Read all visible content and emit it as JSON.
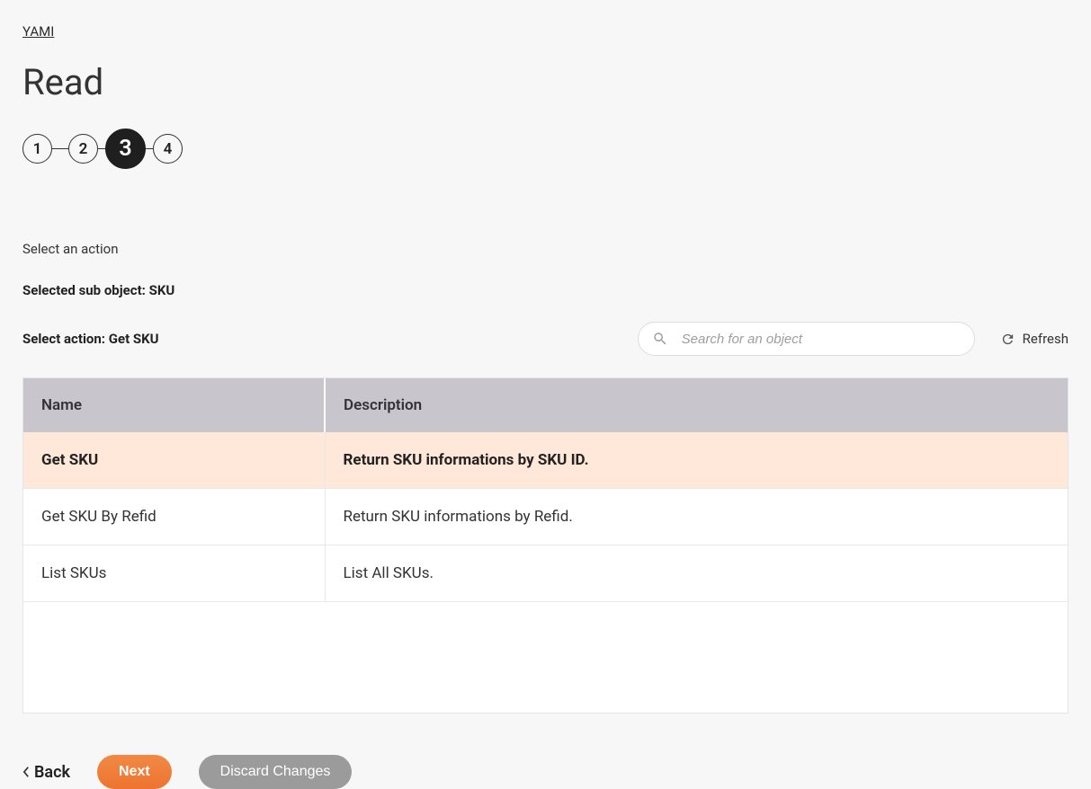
{
  "breadcrumb": {
    "link": "YAMI"
  },
  "pageTitle": "Read",
  "stepper": {
    "steps": [
      "1",
      "2",
      "3",
      "4"
    ],
    "activeIndex": 2
  },
  "instruction": "Select an action",
  "subObject": {
    "label": "Selected sub object: ",
    "value": "SKU"
  },
  "selectAction": {
    "label": "Select action: ",
    "value": "Get SKU"
  },
  "search": {
    "placeholder": "Search for an object"
  },
  "refresh": {
    "label": "Refresh"
  },
  "table": {
    "headers": {
      "name": "Name",
      "description": "Description"
    },
    "rows": [
      {
        "name": "Get SKU",
        "description": "Return SKU informations by SKU ID.",
        "selected": true
      },
      {
        "name": "Get SKU By Refid",
        "description": "Return SKU informations by Refid.",
        "selected": false
      },
      {
        "name": "List SKUs",
        "description": "List All SKUs.",
        "selected": false
      }
    ]
  },
  "buttons": {
    "back": "Back",
    "next": "Next",
    "discard": "Discard Changes"
  }
}
